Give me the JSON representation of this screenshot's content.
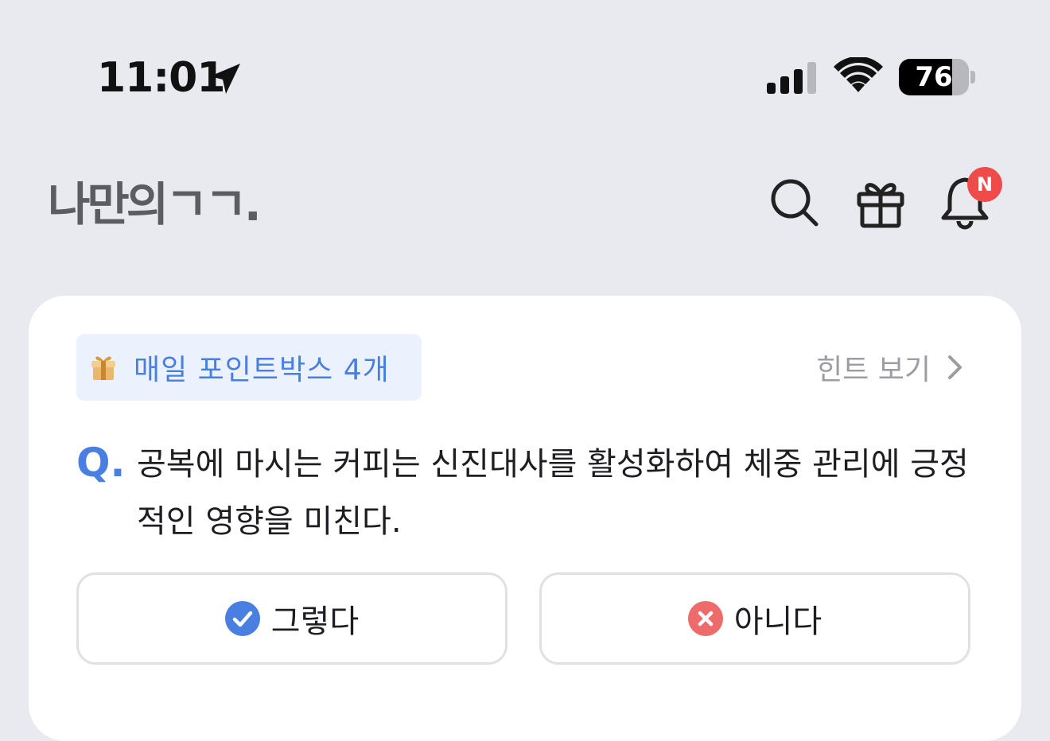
{
  "status_bar": {
    "time": "11:01",
    "battery": "76",
    "battery_level": 0.76
  },
  "header": {
    "logo": "나만의ㄱㄱ.",
    "notification_badge": "N"
  },
  "quiz": {
    "pointbox_label": "매일 포인트박스 4개",
    "hint_label": "힌트 보기",
    "q_prefix": "Q.",
    "question": "공복에 마시는 커피는 신진대사를 활성화하여 체중 관리에 긍정적인 영향을 미친다.",
    "yes_label": "그렇다",
    "no_label": "아니다"
  },
  "colors": {
    "accent_blue": "#4a7fe2",
    "badge_red": "#ef4b4b",
    "no_red": "#ee6b6b",
    "background": "#e9eaef"
  }
}
